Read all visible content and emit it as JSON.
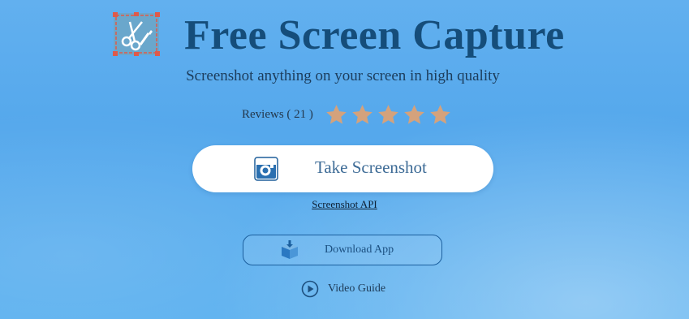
{
  "header": {
    "title": "Free Screen Capture",
    "subtitle": "Screenshot anything on your screen in high quality",
    "logo_icon": "scissors-crop-icon"
  },
  "reviews": {
    "label": "Reviews ( 21 )",
    "rating": 5,
    "max_rating": 5,
    "star_color": "#d4a27c"
  },
  "actions": {
    "take_screenshot_label": "Take Screenshot",
    "take_screenshot_icon": "camera-icon",
    "api_link_label": "Screenshot API",
    "download_label": "Download App",
    "download_icon": "box-download-icon",
    "video_guide_label": "Video Guide",
    "video_guide_icon": "play-circle-icon"
  },
  "colors": {
    "background": "#5aaeee",
    "title": "#154d7a",
    "accent": "#1b5f9e"
  }
}
